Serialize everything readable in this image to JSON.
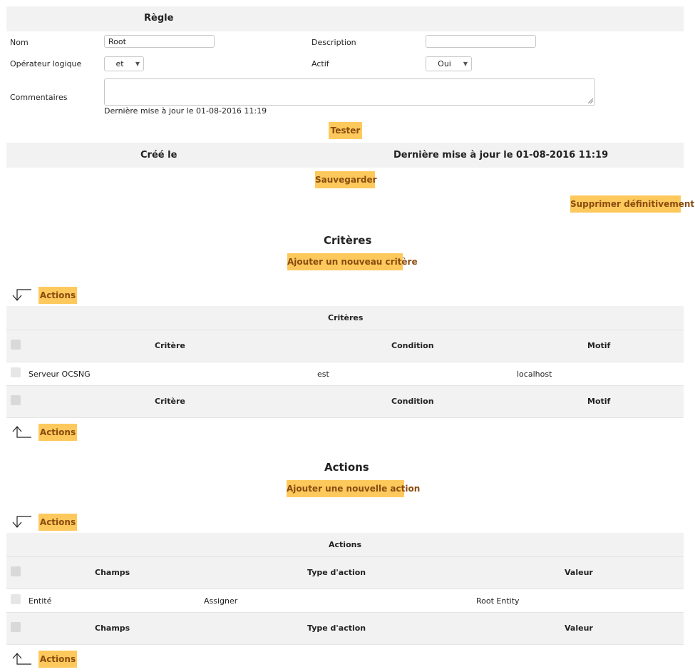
{
  "form": {
    "header": "Règle",
    "nom_label": "Nom",
    "nom_value": "Root",
    "description_label": "Description",
    "description_value": "",
    "operator_label": "Opérateur logique",
    "operator_value": "et",
    "actif_label": "Actif",
    "actif_value": "Oui",
    "comments_label": "Commentaires",
    "comments_value": "",
    "last_update": "Dernière mise à jour le 01-08-2016 11:19",
    "test_button": "Tester"
  },
  "meta_bar": {
    "created_label": "Créé le",
    "updated_label": "Dernière mise à jour le 01-08-2016 11:19"
  },
  "buttons": {
    "save": "Sauvegarder",
    "purge": "Supprimer définitivement"
  },
  "criteria": {
    "title": "Critères",
    "add_button": "Ajouter un nouveau critère",
    "actions_button": "Actions",
    "table_caption": "Critères",
    "headers": [
      "Critère",
      "Condition",
      "Motif"
    ],
    "rows": [
      {
        "critere": "Serveur OCSNG",
        "condition": "est",
        "motif": "localhost"
      }
    ]
  },
  "actions": {
    "title": "Actions",
    "add_button": "Ajouter une nouvelle action",
    "actions_button": "Actions",
    "table_caption": "Actions",
    "headers": [
      "Champs",
      "Type d'action",
      "Valeur"
    ],
    "rows": [
      {
        "champs": "Entité",
        "type": "Assigner",
        "valeur": "Root Entity"
      }
    ]
  },
  "icons": {
    "mass_action_down": "arrow-down-left-icon",
    "mass_action_up": "arrow-up-left-icon",
    "select_arrow": "triangle-down-icon"
  },
  "colors": {
    "button_bg": "#fec95c",
    "button_text": "#8a4b0e",
    "header_bg": "#f2f2f2"
  }
}
